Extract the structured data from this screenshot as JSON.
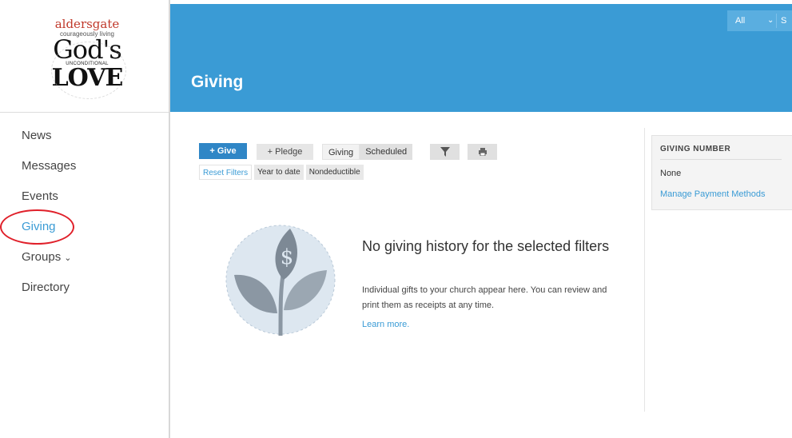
{
  "logo": {
    "line1": "aldersgate",
    "line2": "courageously living",
    "line3": "God's",
    "line4": "UNCONDITIONAL",
    "line5": "LOVE"
  },
  "sidebar": {
    "items": [
      {
        "label": "News"
      },
      {
        "label": "Messages"
      },
      {
        "label": "Events"
      },
      {
        "label": "Giving",
        "active": true
      },
      {
        "label": "Groups",
        "icon": "chevron-down-icon"
      },
      {
        "label": "Directory"
      }
    ]
  },
  "header": {
    "title": "Giving",
    "select_value": "All",
    "select_next": "S"
  },
  "toolbar": {
    "give_label": "Give",
    "pledge_label": "Pledge",
    "tab_giving": "Giving",
    "tab_scheduled": "Scheduled",
    "filter_icon": "filter-icon",
    "print_icon": "print-icon"
  },
  "filters": {
    "reset": "Reset Filters",
    "chips": [
      "Year to date",
      "Nondeductible"
    ]
  },
  "empty_state": {
    "title": "No giving history for the selected filters",
    "text": "Individual gifts to your church appear here. You can review and print them as receipts at any time.",
    "link": "Learn more."
  },
  "panel": {
    "title": "GIVING NUMBER",
    "value": "None",
    "link": "Manage Payment Methods"
  },
  "colors": {
    "brand": "#3a9bd5",
    "primary_button": "#2f86c6",
    "annotation_ring": "#e0202a"
  }
}
